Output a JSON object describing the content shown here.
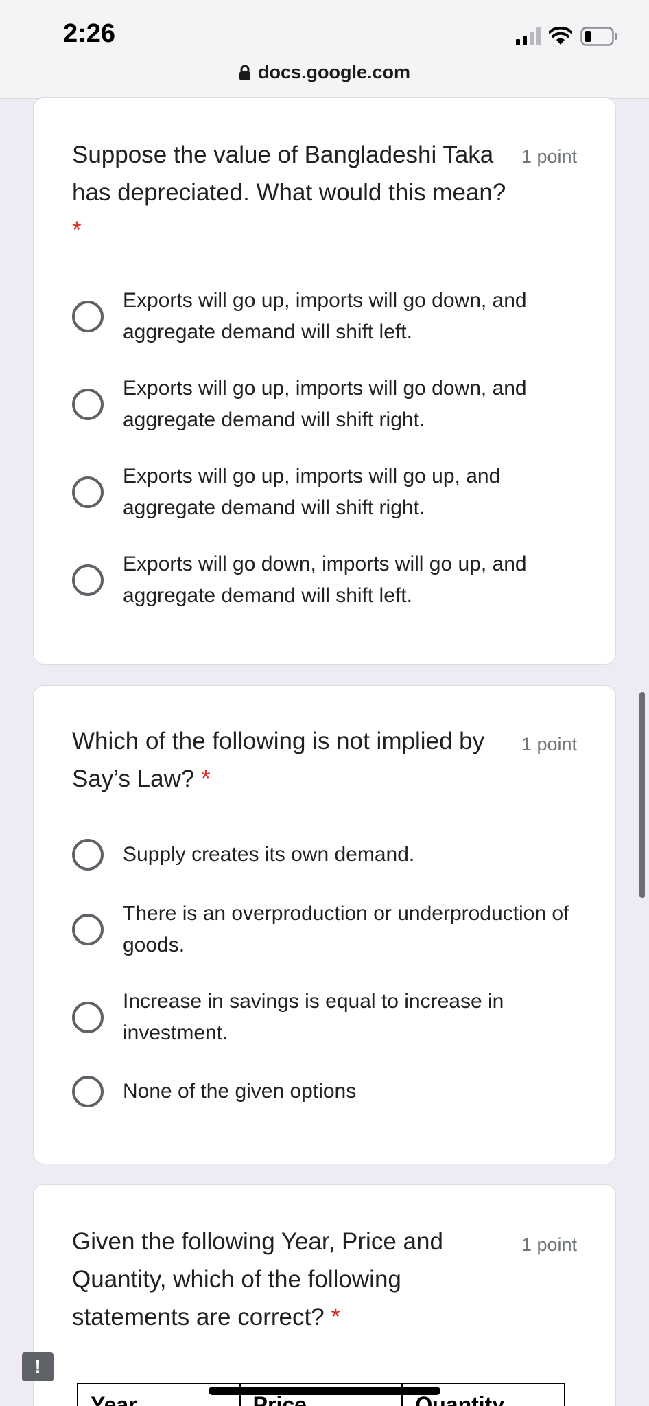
{
  "status_bar": {
    "time": "2:26"
  },
  "address_bar": {
    "url": "docs.google.com"
  },
  "questions": [
    {
      "title": "Suppose the value of Bangladeshi Taka has depreciated. What would this mean?",
      "required_marker": "*",
      "points": "1 point",
      "options": [
        "Exports will go up, imports will go down, and aggregate demand will shift left.",
        "Exports will go up, imports will go down, and aggregate demand will shift right.",
        "Exports will go up, imports will go up, and aggregate demand will shift right.",
        "Exports will go down, imports will go up, and aggregate demand will shift left."
      ]
    },
    {
      "title": "Which of the following is not implied by Say’s Law?",
      "required_marker": "*",
      "points": "1 point",
      "options": [
        "Supply creates its own demand.",
        "There is an overproduction or underproduction of goods.",
        "Increase in savings is equal to increase in investment.",
        "None of the given options"
      ]
    },
    {
      "title": "Given the following Year, Price and Quantity, which of the following statements are correct?",
      "required_marker": "*",
      "points": "1 point",
      "table_headers": [
        "Year",
        "Price",
        "Quantity"
      ]
    }
  ],
  "feedback_button": {
    "label": "!"
  },
  "colors": {
    "page_background": "#efebf5",
    "required_star": "#d93025",
    "radio_border": "#5f6368"
  }
}
